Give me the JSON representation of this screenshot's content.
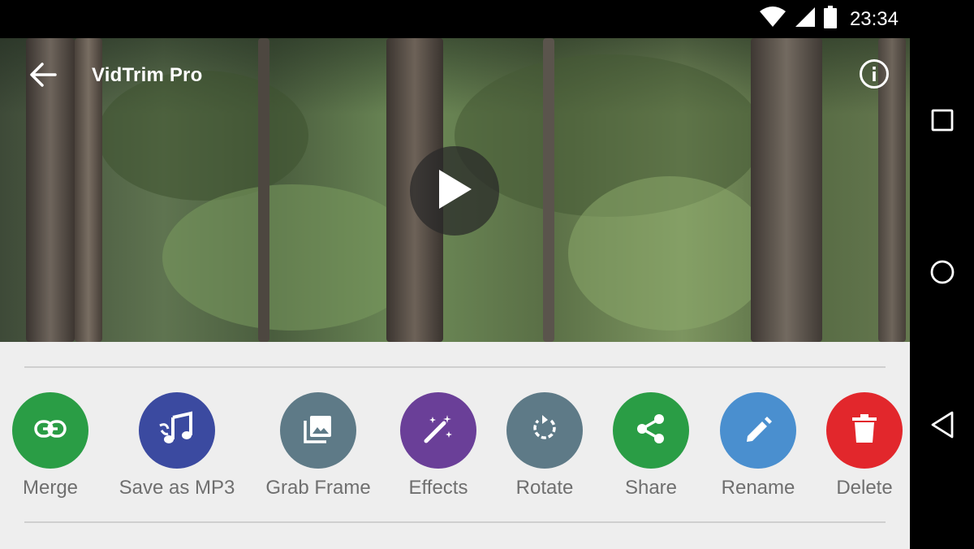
{
  "status_bar": {
    "time": "23:34",
    "icons": [
      "wifi-icon",
      "cellular-signal-icon",
      "battery-icon"
    ]
  },
  "app_bar": {
    "title": "VidTrim Pro",
    "back_icon": "arrow-back-icon",
    "info_icon": "info-icon"
  },
  "video": {
    "play_icon": "play-icon"
  },
  "actions": [
    {
      "id": "merge",
      "label": "Merge",
      "icon": "link-icon",
      "color": "#2a9d45"
    },
    {
      "id": "save-as-mp3",
      "label": "Save as MP3",
      "icon": "music-note-icon",
      "color": "#3b4aa0"
    },
    {
      "id": "grab-frame",
      "label": "Grab Frame",
      "icon": "image-library-icon",
      "color": "#5e7a87"
    },
    {
      "id": "effects",
      "label": "Effects",
      "icon": "magic-wand-icon",
      "color": "#6a3f98"
    },
    {
      "id": "rotate",
      "label": "Rotate",
      "icon": "rotate-icon",
      "color": "#5e7a87"
    },
    {
      "id": "share",
      "label": "Share",
      "icon": "share-icon",
      "color": "#2a9d45"
    },
    {
      "id": "rename",
      "label": "Rename",
      "icon": "pencil-icon",
      "color": "#4a8fcf"
    },
    {
      "id": "delete",
      "label": "Delete",
      "icon": "trash-icon",
      "color": "#e2272c"
    }
  ],
  "nav_bar": {
    "recents_icon": "square-icon",
    "home_icon": "circle-icon",
    "back_icon": "triangle-back-icon"
  }
}
